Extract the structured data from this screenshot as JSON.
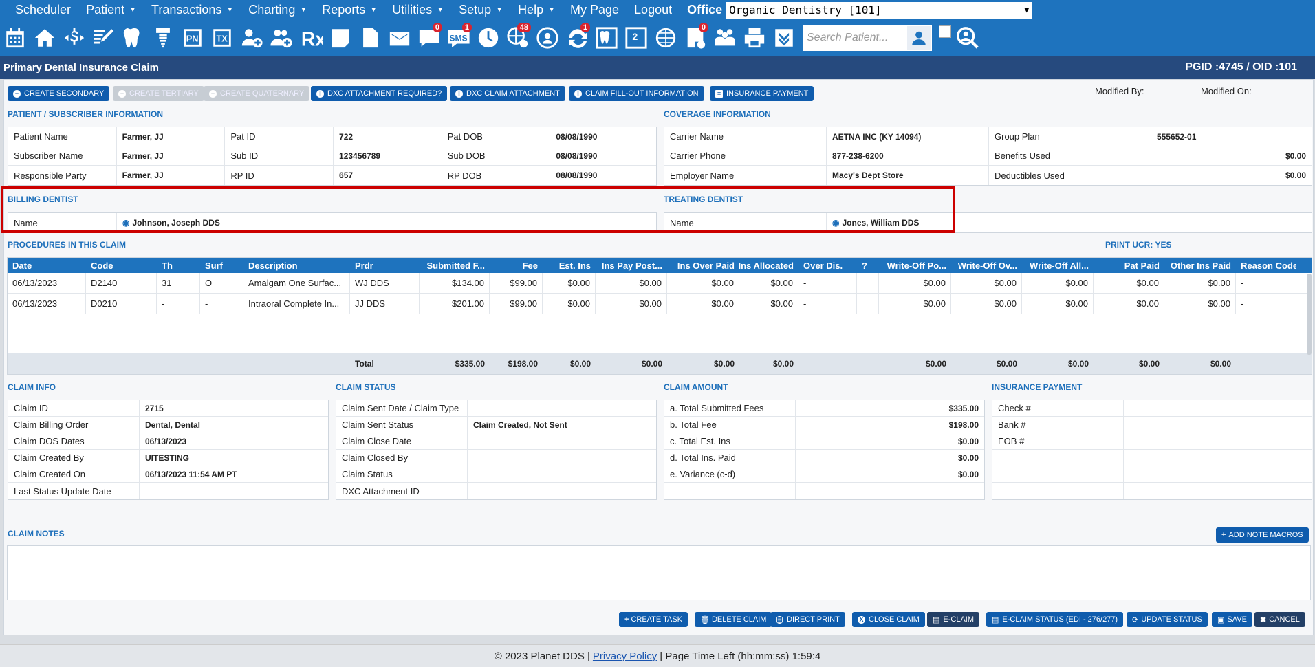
{
  "nav": {
    "items": [
      "Scheduler",
      "Patient",
      "Transactions",
      "Charting",
      "Reports",
      "Utilities",
      "Setup",
      "Help",
      "My Page",
      "Logout"
    ],
    "office_label": "Office",
    "office_value": "Organic Dentistry [101]"
  },
  "iconbar": {
    "search_placeholder": "Search Patient...",
    "sms_label": "SMS",
    "badges": {
      "messages": "0",
      "sms": "1",
      "web": "48",
      "sync": "1",
      "doc": "0"
    }
  },
  "title": {
    "text": "Primary Dental Insurance Claim",
    "ids": "PGID :4745  /  OID :101"
  },
  "toolbar": {
    "create_secondary": "CREATE SECONDARY",
    "create_tertiary": "CREATE TERTIARY",
    "create_quaternary": "CREATE QUATERNARY",
    "dxc_required": "DXC ATTACHMENT REQUIRED?",
    "dxc_attach": "DXC CLAIM ATTACHMENT",
    "fillout": "CLAIM FILL-OUT INFORMATION",
    "ins_payment": "INSURANCE PAYMENT",
    "modified_by": "Modified By:",
    "modified_on": "Modified On:"
  },
  "patient_info": {
    "title": "PATIENT / SUBSCRIBER INFORMATION",
    "rows": [
      [
        "Patient Name",
        "Farmer, JJ",
        "Pat ID",
        "722",
        "Pat DOB",
        "08/08/1990"
      ],
      [
        "Subscriber Name",
        "Farmer, JJ",
        "Sub ID",
        "123456789",
        "Sub DOB",
        "08/08/1990"
      ],
      [
        "Responsible Party",
        "Farmer, JJ",
        "RP ID",
        "657",
        "RP DOB",
        "08/08/1990"
      ]
    ]
  },
  "coverage": {
    "title": "COVERAGE INFORMATION",
    "rows": [
      [
        "Carrier Name",
        "AETNA INC (KY 14094)",
        "Group Plan",
        "555652-01"
      ],
      [
        "Carrier Phone",
        "877-238-6200",
        "Benefits Used",
        "$0.00"
      ],
      [
        "Employer Name",
        "Macy's Dept Store",
        "Deductibles Used",
        "$0.00"
      ]
    ]
  },
  "billing": {
    "title": "BILLING DENTIST",
    "label": "Name",
    "value": "Johnson, Joseph DDS"
  },
  "treating": {
    "title": "TREATING DENTIST",
    "label": "Name",
    "value": "Jones, William DDS"
  },
  "procedures": {
    "title": "PROCEDURES IN THIS CLAIM",
    "print_ucr": "PRINT UCR: YES",
    "headers": [
      "Date",
      "Code",
      "Th",
      "Surf",
      "Description",
      "Prdr",
      "Submitted F...",
      "Fee",
      "Est. Ins",
      "Ins Pay Post...",
      "Ins Over Paid",
      "Ins Allocated",
      "Over Dis.",
      "?",
      "Write-Off Po...",
      "Write-Off Ov...",
      "Write-Off All...",
      "Pat Paid",
      "Other Ins Paid",
      "Reason Code"
    ],
    "rows": [
      [
        "06/13/2023",
        "D2140",
        "31",
        "O",
        "Amalgam One Surfac...",
        "WJ DDS",
        "$134.00",
        "$99.00",
        "$0.00",
        "$0.00",
        "$0.00",
        "$0.00",
        "-",
        "",
        "$0.00",
        "$0.00",
        "$0.00",
        "$0.00",
        "$0.00",
        "-"
      ],
      [
        "06/13/2023",
        "D0210",
        "-",
        "-",
        "Intraoral Complete In...",
        "JJ DDS",
        "$201.00",
        "$99.00",
        "$0.00",
        "$0.00",
        "$0.00",
        "$0.00",
        "-",
        "",
        "$0.00",
        "$0.00",
        "$0.00",
        "$0.00",
        "$0.00",
        "-"
      ]
    ],
    "total": [
      "",
      "",
      "",
      "",
      "",
      "Total",
      "$335.00",
      "$198.00",
      "$0.00",
      "$0.00",
      "$0.00",
      "$0.00",
      "",
      "",
      "$0.00",
      "$0.00",
      "$0.00",
      "$0.00",
      "$0.00",
      ""
    ]
  },
  "claim_info": {
    "title": "CLAIM INFO",
    "rows": [
      [
        "Claim ID",
        "2715"
      ],
      [
        "Claim Billing Order",
        "Dental, Dental"
      ],
      [
        "Claim DOS Dates",
        "06/13/2023"
      ],
      [
        "Claim Created By",
        "UITESTING"
      ],
      [
        "Claim Created On",
        "06/13/2023 11:54 AM PT"
      ],
      [
        "Last Status Update Date",
        ""
      ]
    ]
  },
  "claim_status": {
    "title": "CLAIM STATUS",
    "rows": [
      [
        "Claim Sent Date / Claim Type",
        ""
      ],
      [
        "Claim Sent Status",
        "Claim Created, Not Sent"
      ],
      [
        "Claim Close Date",
        ""
      ],
      [
        "Claim Closed By",
        ""
      ],
      [
        "Claim Status",
        ""
      ],
      [
        "DXC Attachment ID",
        ""
      ]
    ]
  },
  "claim_amount": {
    "title": "CLAIM AMOUNT",
    "rows": [
      [
        "a. Total Submitted Fees",
        "$335.00"
      ],
      [
        "b. Total Fee",
        "$198.00"
      ],
      [
        "c. Total Est. Ins",
        "$0.00"
      ],
      [
        "d. Total Ins. Paid",
        "$0.00"
      ],
      [
        "e. Variance (c-d)",
        "$0.00"
      ],
      [
        "",
        ""
      ]
    ]
  },
  "insurance_payment": {
    "title": "INSURANCE PAYMENT",
    "rows": [
      [
        "Check #",
        ""
      ],
      [
        "Bank #",
        ""
      ],
      [
        "EOB #",
        ""
      ],
      [
        "",
        ""
      ],
      [
        "",
        ""
      ],
      [
        "",
        ""
      ]
    ]
  },
  "notes": {
    "title": "CLAIM NOTES",
    "add_macros": "ADD NOTE MACROS"
  },
  "actions": {
    "create_task": "CREATE TASK",
    "delete_claim": "DELETE CLAIM",
    "direct_print": "DIRECT PRINT",
    "close_claim": "CLOSE CLAIM",
    "eclaim": "E-CLAIM",
    "eclaim_status": "E-CLAIM STATUS (EDI - 276/277)",
    "update_status": "UPDATE STATUS",
    "save": "SAVE",
    "cancel": "CANCEL"
  },
  "footer": {
    "copyright": "© 2023 Planet DDS |",
    "privacy": "Privacy Policy",
    "time_left": "| Page Time Left (hh:mm:ss) 1:59:4"
  }
}
